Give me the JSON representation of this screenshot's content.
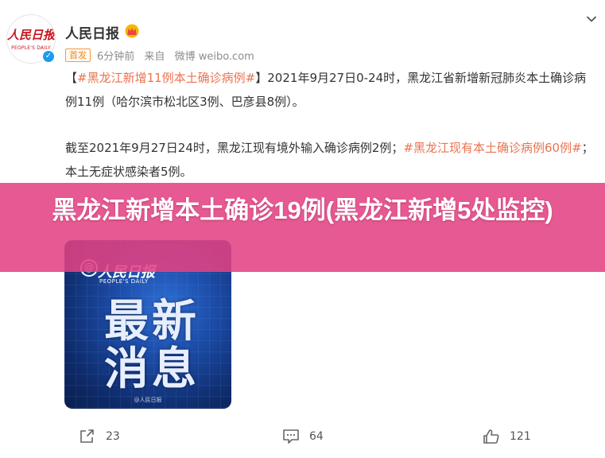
{
  "post": {
    "avatar_logo": "人民日报",
    "avatar_sub": "PEOPLE'S DAILY",
    "username": "人民日报",
    "badge": "首发",
    "time": "6分钟前",
    "source_prefix": "来自",
    "source": "微博 weibo.com",
    "paragraph1": {
      "open_bracket": "【",
      "hashtag": "#黑龙江新增11例本土确诊病例#",
      "close_bracket": "】",
      "text": "2021年9月27日0-24时，黑龙江省新增新冠肺炎本土确诊病例11例（哈尔滨市松北区3例、巴彦县8例）。"
    },
    "paragraph2": {
      "text_before": "截至2021年9月27日24时，黑龙江现有境外输入确诊病例2例；",
      "hashtag": "#黑龙江现有本土确诊病例60例#",
      "text_after": "；本土无症状感染者5例。"
    },
    "image": {
      "brand": "人民日报",
      "brand_at": "@",
      "brand_sub": "PEOPLE'S DAILY",
      "line1": "最新",
      "line2": "消息",
      "watermark": "@人民日报"
    }
  },
  "overlay": {
    "title": "黑龙江新增本土确诊19例(黑龙江新增5处监控)"
  },
  "actions": {
    "repost_count": "23",
    "comment_count": "64",
    "like_count": "121"
  },
  "icons": {
    "more": "chevron-down-icon",
    "repost": "share-icon",
    "comment": "comment-icon",
    "like": "thumbs-up-icon",
    "crown": "crown-icon",
    "verified": "verified-icon"
  },
  "colors": {
    "hashtag": "#eb7350",
    "banner": "#e24284",
    "badge": "#f08a24",
    "verified": "#1d9bf0"
  }
}
